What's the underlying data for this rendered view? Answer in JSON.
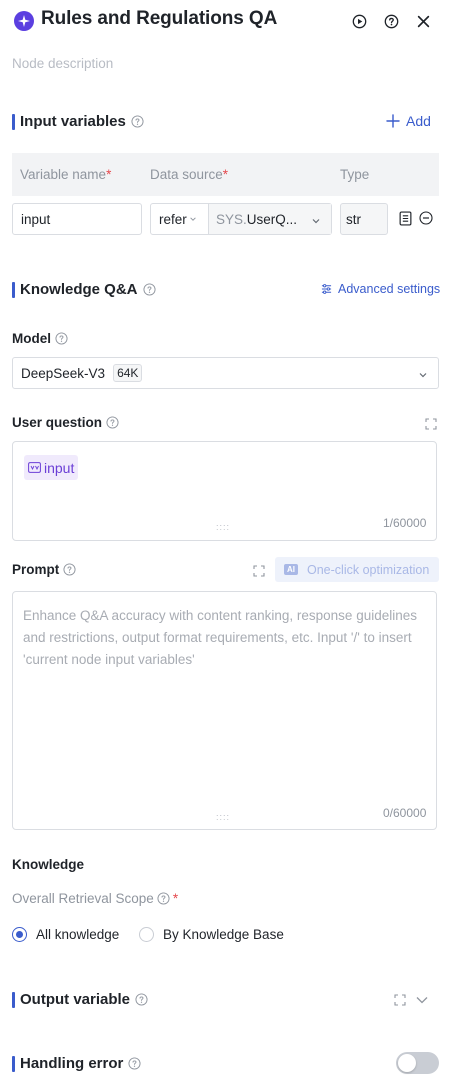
{
  "header": {
    "title": "Rules and Regulations QA",
    "description_placeholder": "Node description"
  },
  "input_variables": {
    "title": "Input variables",
    "add_label": "Add",
    "columns": {
      "name": "Variable name",
      "source": "Data source",
      "type": "Type"
    },
    "required_mark": "*",
    "row": {
      "name": "input",
      "mode": "refer",
      "source_prefix": "SYS.",
      "source_value": "UserQ...",
      "type": "str"
    }
  },
  "knowledge_qa": {
    "title": "Knowledge Q&A",
    "advanced_label": "Advanced settings",
    "model_label": "Model",
    "model_name": "DeepSeek-V3",
    "model_badge": "64K",
    "user_question_label": "User question",
    "user_question_tag": "input",
    "user_question_counter": "1/60000",
    "prompt_label": "Prompt",
    "optimize_label": "One-click optimization",
    "prompt_placeholder": "Enhance Q&A accuracy with content ranking, response guidelines and restrictions, output format requirements, etc. Input '/' to insert 'current node input variables'",
    "prompt_counter": "0/60000"
  },
  "knowledge": {
    "label": "Knowledge",
    "scope_label": "Overall Retrieval Scope",
    "options": [
      "All knowledge",
      "By Knowledge Base"
    ],
    "selected": "All knowledge"
  },
  "output_variable": {
    "title": "Output variable"
  },
  "handling_error": {
    "title": "Handling error",
    "enabled": false
  },
  "colors": {
    "accent": "#3a5ccc",
    "logo": "#5b3fe0",
    "required": "#e5484d",
    "tag_bg": "#f0eafc"
  },
  "icons": {
    "logo": "sparkle-icon",
    "run": "play-circle-icon",
    "help": "question-circle-icon",
    "close": "close-icon",
    "add": "plus-icon",
    "settings": "sliders-icon",
    "expand": "expand-icon",
    "chevron": "chevron-down-icon",
    "doc": "document-icon",
    "remove": "minus-circle-icon"
  }
}
